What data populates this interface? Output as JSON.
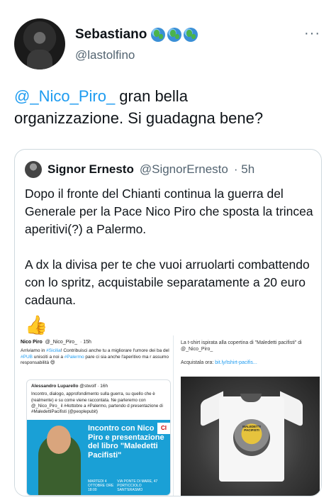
{
  "author": {
    "name": "Sebastiano",
    "handle": "@lastolfino",
    "emoji": [
      "globe-icon",
      "globe-icon",
      "globe-icon"
    ],
    "more_label": "···"
  },
  "tweet": {
    "mention": "@_Nico_Piro_",
    "text_line1": " gran bella",
    "text_line2": "organizzazione.  Si guadagna bene?"
  },
  "quote": {
    "name": "Signor Ernesto",
    "handle": "@SignorErnesto",
    "time": "· 5h",
    "paragraph1": "Dopo il fronte del Chianti continua la guerra del Generale per la Pace Nico Piro che sposta la trincea aperitivi(?) a Palermo.",
    "paragraph2": "A dx la divisa per te che vuoi arruolarti combattendo con lo spritz, acquistabile separatamente a 20 euro cadauna.",
    "emoji": "👍"
  },
  "left_media": {
    "name": "Nico Piro",
    "handle": "@_Nico_Piro_",
    "time": "· 15h",
    "text_a": "Arriviamo in ",
    "text_b": "#Sicilia",
    "text_c": "! Contribuisci anche tu a migliorare l'umore dei ba del ",
    "text_d": "#PUB",
    "text_e": " unisciti a noi a ",
    "text_f": "#Palermo",
    "text_g": " pare ci sia anche l'aperitivo ma r assumo responsabilità 😄",
    "inner_name": "Alessandro Luparello",
    "inner_handle": "@stwolf",
    "inner_time": "· 16h",
    "inner_text": "Incontro, dialogo, approfondimento sulla guerra, su quello che è (realmente) e su come viene raccontata. Ne parleremo con @_Nico_Piro_ il #4ottobre a #Palermo, partendo d presentazione di #MaledettiPacifisti (@peoplepubit)",
    "poster_title": "Incontro con Nico Piro e presentazione del libro \"Maledetti Pacifisti\"",
    "poster_date": "MARTEDI 4 OTTOBRE ORE 18:00",
    "poster_place": "VIA PONTE DI MARE, 47 PORTICCIOLO SANT'ERASMO",
    "poster_badge": "CI"
  },
  "right_media": {
    "caption": "La t-shirt ispirata alla copertina di \"Maledetti pacifisti\" di @_Nico_Piro_",
    "buy_label": "Acquistala ora: ",
    "buy_link": "bit.ly/tshirt-pacifis...",
    "print_text": "MALEDETTI PACIFISTI"
  }
}
